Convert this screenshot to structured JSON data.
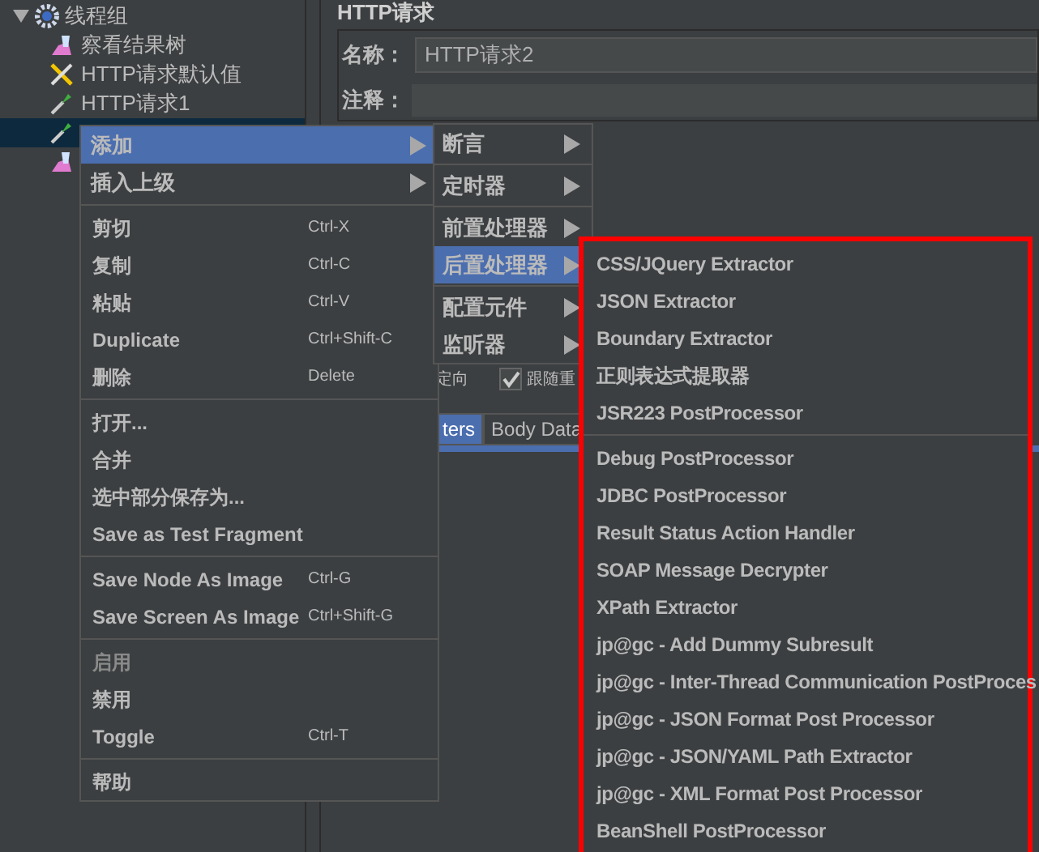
{
  "tree": {
    "label": "线程组",
    "expanded": true,
    "children": [
      {
        "label": "察看结果树",
        "kind": "listener",
        "selected": false
      },
      {
        "label": "HTTP请求默认值",
        "kind": "config",
        "selected": false
      },
      {
        "label": "HTTP请求1",
        "kind": "sampler",
        "selected": false
      },
      {
        "kind": "sampler",
        "selected": true
      },
      {
        "kind": "listener",
        "selected": false
      }
    ]
  },
  "editor": {
    "title": "HTTP请求",
    "name_label": "名称：",
    "name_value": "HTTP请求2",
    "comment_label": "注释：",
    "redirect_label": "定向",
    "follow_checked": true,
    "follow_label": "跟随重",
    "tabs": [
      {
        "label": "ters",
        "selected": true
      },
      {
        "label": "Body Data",
        "selected": false
      }
    ]
  },
  "context_menu": [
    {
      "kind": "submenu",
      "label": "添加",
      "selected": true
    },
    {
      "kind": "submenu",
      "label": "插入上级",
      "selected": false
    },
    {
      "kind": "separator"
    },
    {
      "kind": "item",
      "label": "剪切",
      "shortcut": "Ctrl-X",
      "disabled": false
    },
    {
      "kind": "item",
      "label": "复制",
      "shortcut": "Ctrl-C",
      "disabled": false
    },
    {
      "kind": "item",
      "label": "粘贴",
      "shortcut": "Ctrl-V",
      "disabled": false
    },
    {
      "kind": "item",
      "label": "Duplicate",
      "shortcut": "Ctrl+Shift-C",
      "disabled": false
    },
    {
      "kind": "item",
      "label": "删除",
      "shortcut": "Delete",
      "disabled": false
    },
    {
      "kind": "separator"
    },
    {
      "kind": "item",
      "label": "打开...",
      "disabled": false
    },
    {
      "kind": "item",
      "label": "合并",
      "disabled": false
    },
    {
      "kind": "item",
      "label": "选中部分保存为...",
      "disabled": false
    },
    {
      "kind": "item",
      "label": "Save as Test Fragment",
      "disabled": false
    },
    {
      "kind": "separator"
    },
    {
      "kind": "item",
      "label": "Save Node As Image",
      "shortcut": "Ctrl-G",
      "disabled": false
    },
    {
      "kind": "item",
      "label": "Save Screen As Image",
      "shortcut": "Ctrl+Shift-G",
      "disabled": false
    },
    {
      "kind": "separator"
    },
    {
      "kind": "item",
      "label": "启用",
      "disabled": true
    },
    {
      "kind": "item",
      "label": "禁用",
      "disabled": false
    },
    {
      "kind": "item",
      "label": "Toggle",
      "shortcut": "Ctrl-T",
      "disabled": false
    },
    {
      "kind": "separator"
    },
    {
      "kind": "item",
      "label": "帮助",
      "disabled": false
    }
  ],
  "add_menu": [
    {
      "kind": "submenu",
      "label": "断言",
      "selected": false
    },
    {
      "kind": "separator"
    },
    {
      "kind": "submenu",
      "label": "定时器",
      "selected": false
    },
    {
      "kind": "separator"
    },
    {
      "kind": "submenu",
      "label": "前置处理器",
      "selected": false
    },
    {
      "kind": "submenu",
      "label": "后置处理器",
      "selected": true
    },
    {
      "kind": "separator"
    },
    {
      "kind": "submenu",
      "label": "配置元件",
      "selected": false
    },
    {
      "kind": "submenu",
      "label": "监听器",
      "selected": false
    }
  ],
  "postprocessor_menu": [
    {
      "kind": "item",
      "label": "CSS/JQuery Extractor"
    },
    {
      "kind": "item",
      "label": "JSON Extractor"
    },
    {
      "kind": "item",
      "label": "Boundary Extractor"
    },
    {
      "kind": "item",
      "label": "正则表达式提取器"
    },
    {
      "kind": "item",
      "label": "JSR223 PostProcessor"
    },
    {
      "kind": "separator"
    },
    {
      "kind": "item",
      "label": "Debug PostProcessor"
    },
    {
      "kind": "item",
      "label": "JDBC PostProcessor"
    },
    {
      "kind": "item",
      "label": "Result Status Action Handler"
    },
    {
      "kind": "item",
      "label": "SOAP Message Decrypter"
    },
    {
      "kind": "item",
      "label": "XPath Extractor"
    },
    {
      "kind": "item",
      "label": "jp@gc - Add Dummy Subresult"
    },
    {
      "kind": "item",
      "label": "jp@gc - Inter-Thread Communication PostProces"
    },
    {
      "kind": "item",
      "label": "jp@gc - JSON Format Post Processor"
    },
    {
      "kind": "item",
      "label": "jp@gc - JSON/YAML Path Extractor"
    },
    {
      "kind": "item",
      "label": "jp@gc - XML Format Post Processor"
    },
    {
      "kind": "item",
      "label": "BeanShell PostProcessor"
    }
  ]
}
